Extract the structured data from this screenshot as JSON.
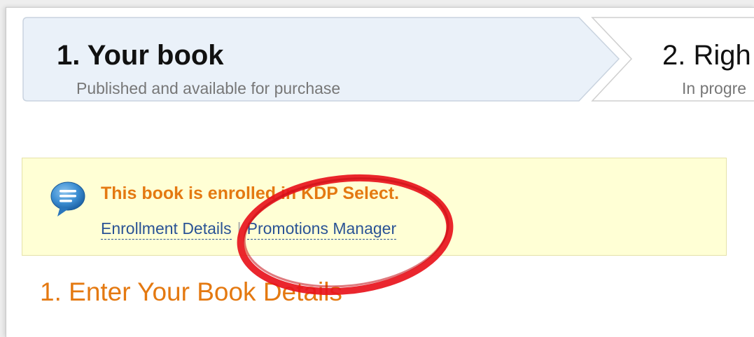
{
  "steps": [
    {
      "title": "1. Your book",
      "subtitle": "Published and available for purchase"
    },
    {
      "title": "2. Righ",
      "subtitle": "In progre"
    }
  ],
  "notice": {
    "icon": "speech-bubble-icon",
    "message": "This book is enrolled in KDP Select.",
    "links": [
      {
        "label": "Enrollment Details"
      },
      {
        "label": "Promotions Manager"
      }
    ],
    "separator": "|"
  },
  "section": {
    "title": "1. Enter Your Book Details"
  },
  "colors": {
    "accent_orange": "#e47911",
    "link_blue": "#2a5395",
    "notice_bg": "#ffffd5",
    "step_active_bg": "#eaf1f9",
    "highlight_red": "#e8141c"
  }
}
